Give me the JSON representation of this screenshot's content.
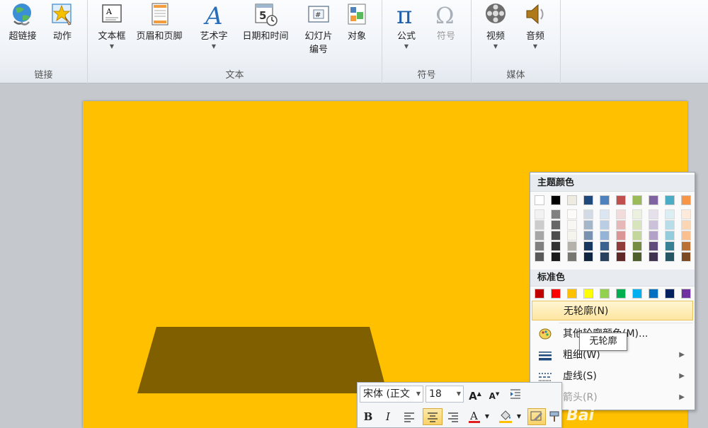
{
  "ribbon": {
    "groups": [
      {
        "label": "链接",
        "buttons": [
          {
            "label": "超链接",
            "icon": "globe-link-icon"
          },
          {
            "label": "动作",
            "icon": "action-star-icon"
          }
        ]
      },
      {
        "label": "文本",
        "buttons": [
          {
            "label": "文本框",
            "icon": "textbox-icon",
            "has_dropdown": true
          },
          {
            "label": "页眉和页脚",
            "icon": "header-footer-icon"
          },
          {
            "label": "艺术字",
            "icon": "wordart-icon",
            "has_dropdown": true
          },
          {
            "label": "日期和时间",
            "icon": "date-time-icon"
          },
          {
            "label": "幻灯片",
            "label2": "编号",
            "icon": "slide-number-icon"
          },
          {
            "label": "对象",
            "icon": "object-icon"
          }
        ]
      },
      {
        "label": "符号",
        "buttons": [
          {
            "label": "公式",
            "icon": "pi-equation-icon",
            "has_dropdown": true
          },
          {
            "label": "符号",
            "icon": "omega-symbol-icon",
            "disabled": true
          }
        ]
      },
      {
        "label": "媒体",
        "buttons": [
          {
            "label": "视频",
            "icon": "film-reel-icon",
            "has_dropdown": true
          },
          {
            "label": "音频",
            "icon": "speaker-icon",
            "has_dropdown": true
          }
        ]
      }
    ]
  },
  "slide": {
    "background": "#ffc000",
    "shape_color": "#7f5f00"
  },
  "color_menu": {
    "theme_header": "主题颜色",
    "theme_colors": [
      "#ffffff",
      "#000000",
      "#eeece1",
      "#1f497d",
      "#4f81bd",
      "#c0504d",
      "#9bbb59",
      "#8064a2",
      "#4bacc6",
      "#f79646"
    ],
    "standard_header": "标准色",
    "standard_colors": [
      "#c00000",
      "#ff0000",
      "#ffc000",
      "#ffff00",
      "#92d050",
      "#00b050",
      "#00b0f0",
      "#0070c0",
      "#002060",
      "#7030a0"
    ],
    "items": [
      {
        "label": "无轮廓(N)",
        "highlighted": true
      },
      {
        "label": "其他轮廓颜色(M)...",
        "icon": "palette-icon"
      },
      {
        "label": "粗细(W)",
        "icon": "line-weight-icon",
        "submenu": true
      },
      {
        "label": "虚线(S)",
        "icon": "dash-line-icon",
        "submenu": true
      },
      {
        "label": "箭头(R)",
        "icon": "arrow-line-icon",
        "submenu": true,
        "disabled": true
      }
    ],
    "tooltip": "无轮廓"
  },
  "mini_toolbar": {
    "font_name": "宋体 (正文",
    "font_size": "18",
    "buttons": [
      "B",
      "I"
    ]
  },
  "watermark": "Bai"
}
